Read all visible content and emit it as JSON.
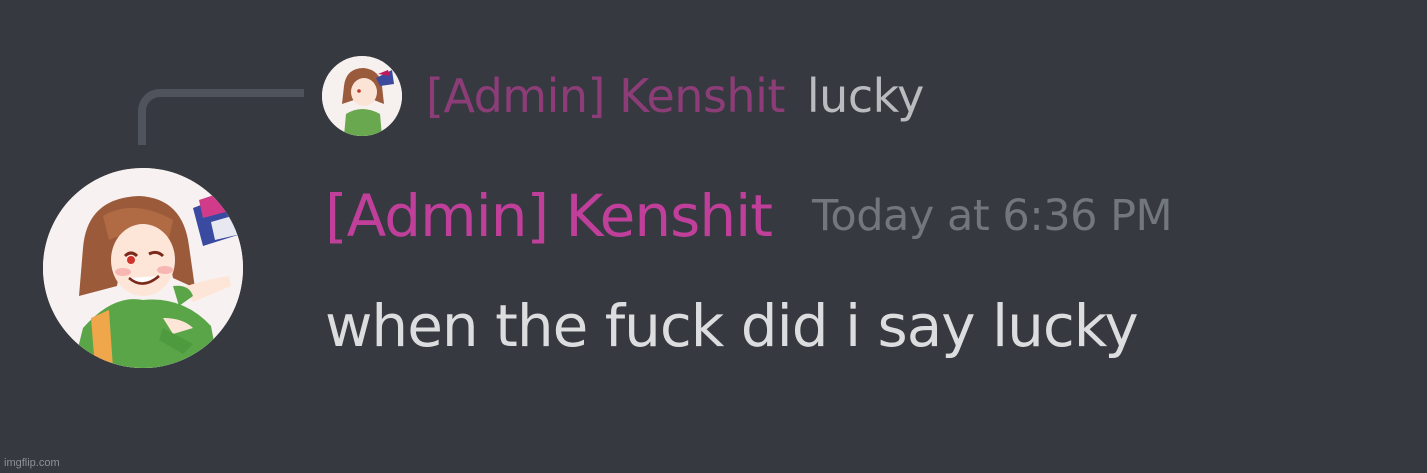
{
  "reply": {
    "author": "[Admin] Kenshit",
    "text": "lucky",
    "author_color": "#8c3d78"
  },
  "message": {
    "author": "[Admin] Kenshit",
    "timestamp": "Today at 6:36 PM",
    "content": "when the fuck did i say lucky",
    "author_color": "#c03f9a"
  },
  "watermark": "imgflip.com",
  "colors": {
    "background": "#36393f",
    "timestamp": "#72767d",
    "content": "#dcddde",
    "reply_spine": "#4f545c"
  }
}
